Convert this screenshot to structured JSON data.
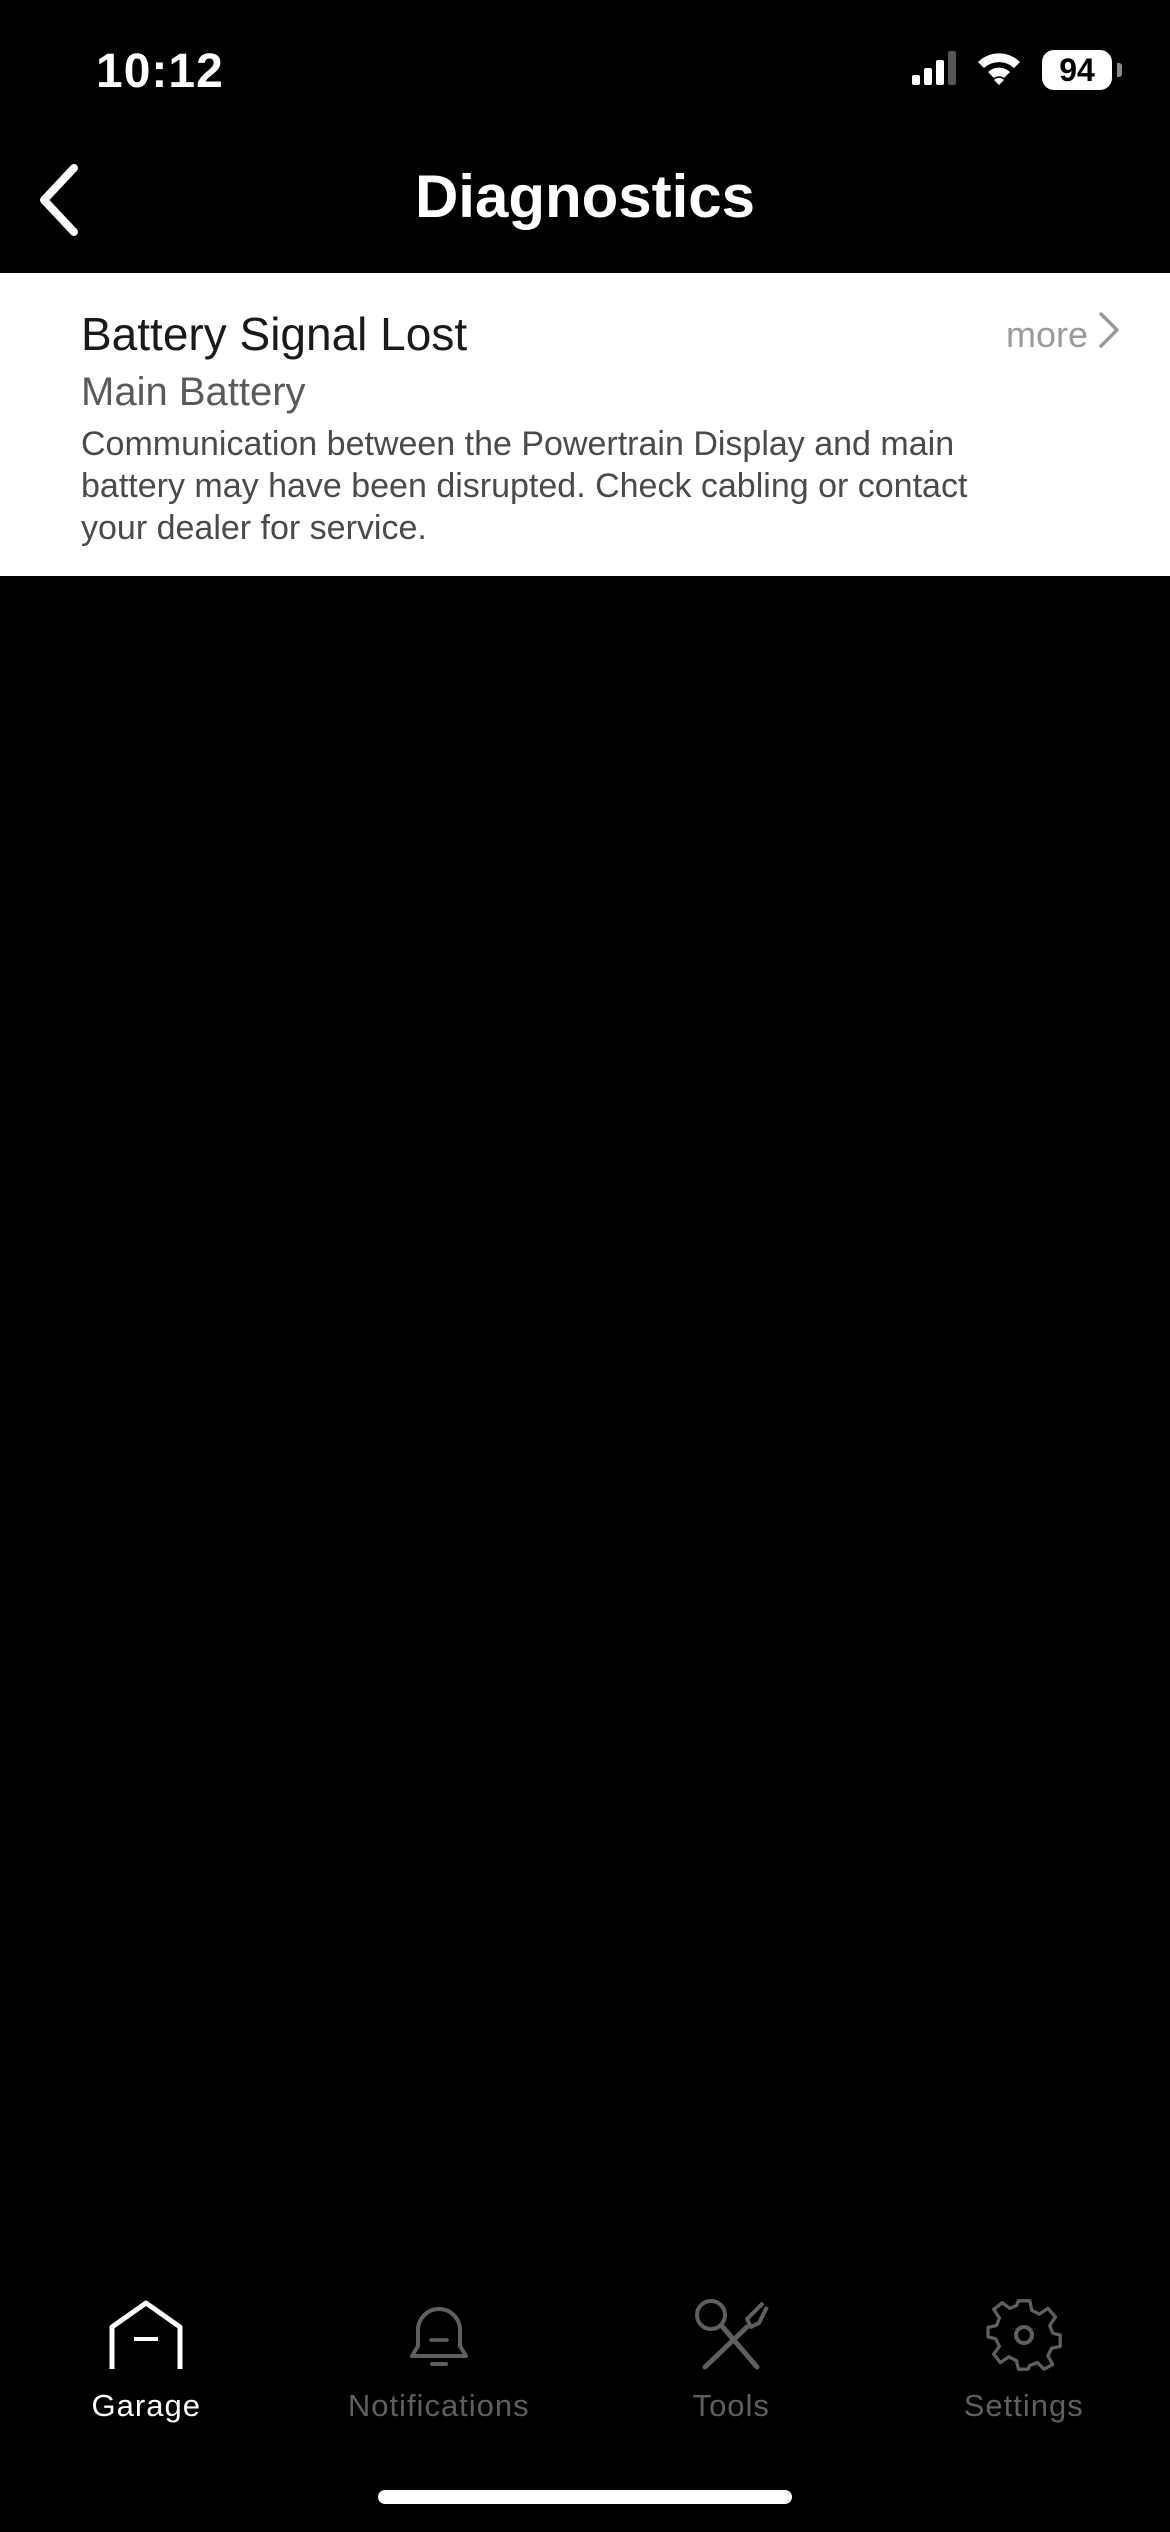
{
  "status_bar": {
    "time": "10:12",
    "battery_level": "94",
    "icons": [
      "cellular-signal-icon",
      "wifi-icon",
      "battery-icon"
    ]
  },
  "nav": {
    "title": "Diagnostics",
    "back_icon": "chevron-left-icon"
  },
  "diagnostics": [
    {
      "title": "Battery Signal Lost",
      "subtitle": "Main Battery",
      "description": "Communication between the Powertrain Display and main battery may have been disrupted. Check cabling or contact your dealer for service.",
      "more_label": "more",
      "more_icon": "chevron-right-icon"
    }
  ],
  "tabs": [
    {
      "label": "Garage",
      "icon": "garage-icon",
      "active": true
    },
    {
      "label": "Notifications",
      "icon": "bell-icon",
      "active": false
    },
    {
      "label": "Tools",
      "icon": "tools-icon",
      "active": false
    },
    {
      "label": "Settings",
      "icon": "gear-icon",
      "active": false
    }
  ],
  "colors": {
    "background": "#000000",
    "card_background": "#ffffff",
    "active_tab": "#ffffff",
    "inactive_tab": "#5f5f5f"
  }
}
